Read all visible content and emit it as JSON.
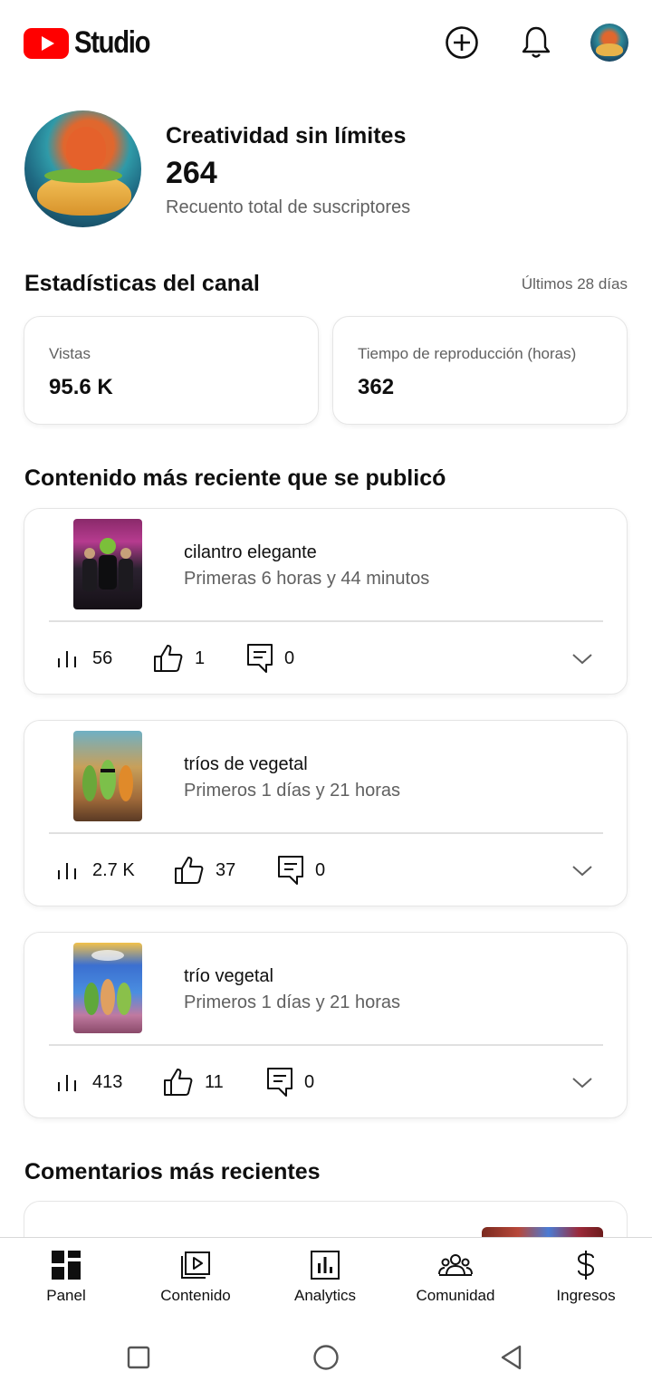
{
  "app": {
    "logo_text": "Studio"
  },
  "topbar": {
    "create_icon": "plus-circle-icon",
    "notifications_icon": "bell-icon",
    "account_icon": "avatar"
  },
  "channel": {
    "name": "Creatividad sin límites",
    "subscribers": "264",
    "subscribers_label": "Recuento total de suscriptores"
  },
  "stats": {
    "title": "Estadísticas del canal",
    "period": "Últimos 28 días",
    "views_label": "Vistas",
    "views_value": "95.6 K",
    "watch_label": "Tiempo de reproducción (horas)",
    "watch_value": "362"
  },
  "latest": {
    "title": "Contenido más reciente que se publicó",
    "videos": [
      {
        "title": "cilantro elegante",
        "subtitle": "Primeras 6 horas y 44 minutos",
        "views": "56",
        "likes": "1",
        "comments": "0"
      },
      {
        "title": "tríos de vegetal",
        "subtitle": "Primeros 1 días y 21 horas",
        "views": "2.7 K",
        "likes": "37",
        "comments": "0"
      },
      {
        "title": "trío vegetal",
        "subtitle": "Primeros 1 días y 21 horas",
        "views": "413",
        "likes": "11",
        "comments": "0"
      }
    ]
  },
  "comments": {
    "title": "Comentarios más recientes"
  },
  "bottom_nav": [
    {
      "label": "Panel",
      "icon": "dashboard-icon",
      "active": true
    },
    {
      "label": "Contenido",
      "icon": "content-icon"
    },
    {
      "label": "Analytics",
      "icon": "analytics-icon"
    },
    {
      "label": "Comunidad",
      "icon": "community-icon"
    },
    {
      "label": "Ingresos",
      "icon": "dollar-icon"
    }
  ],
  "system_nav": [
    "recents-icon",
    "home-icon",
    "back-icon"
  ],
  "colors": {
    "brand_red": "#ff0000",
    "text": "#0f0f0f",
    "secondary_text": "#606060",
    "border": "#e5e5e5"
  }
}
